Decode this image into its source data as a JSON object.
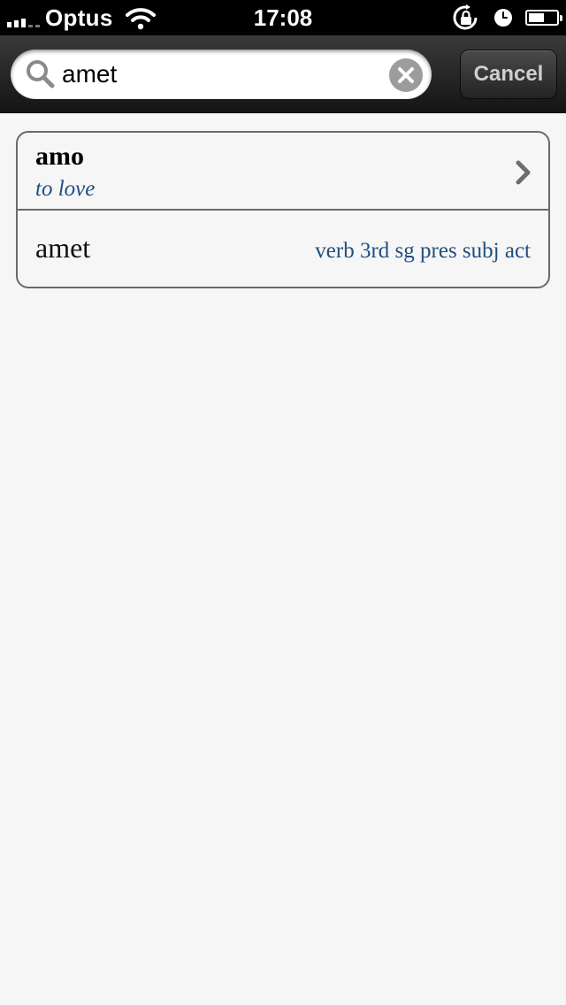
{
  "status_bar": {
    "carrier": "Optus",
    "time": "17:08",
    "signal_bars": 3,
    "battery_level": 0.55,
    "icons": [
      "signal-icon",
      "wifi-icon",
      "rotation-lock-icon",
      "alarm-icon",
      "battery-icon"
    ]
  },
  "search": {
    "query": "amet",
    "cancel_label": "Cancel",
    "icons": [
      "search-icon",
      "clear-icon"
    ]
  },
  "results": {
    "lemma": {
      "word": "amo",
      "gloss": "to love",
      "icon": "chevron-right-icon"
    },
    "form": {
      "word": "amet",
      "parse": "verb 3rd sg pres subj act"
    }
  },
  "colors": {
    "accent_text": "#1f4f82",
    "background": "#f6f6f6",
    "bar_dark": "#141414"
  }
}
